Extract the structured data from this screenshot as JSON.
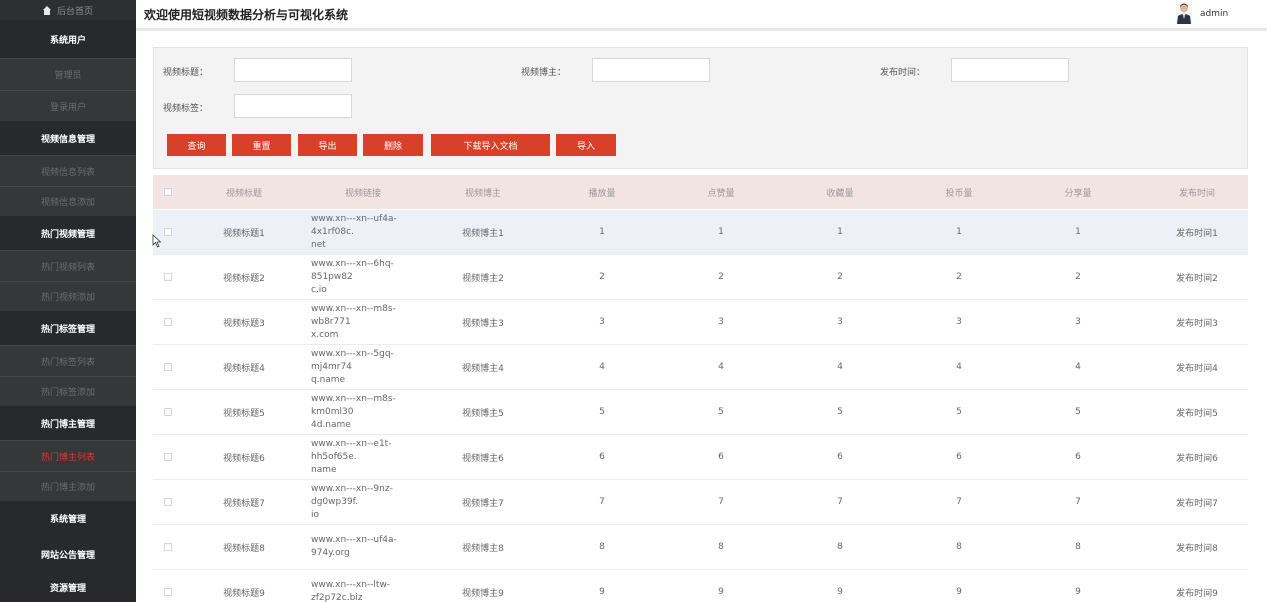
{
  "sidebar": {
    "home_label": "后台首页",
    "items": [
      {
        "label": "系统用户",
        "type": "cat"
      },
      {
        "label": "管理员",
        "type": "sub"
      },
      {
        "label": "登录用户",
        "type": "sub"
      },
      {
        "label": "视频信息管理",
        "type": "cat"
      },
      {
        "label": "视频信息列表",
        "type": "sub"
      },
      {
        "label": "视频信息添加",
        "type": "sub"
      },
      {
        "label": "热门视频管理",
        "type": "cat"
      },
      {
        "label": "热门视频列表",
        "type": "sub"
      },
      {
        "label": "热门视频添加",
        "type": "sub"
      },
      {
        "label": "热门标签管理",
        "type": "cat"
      },
      {
        "label": "热门标签列表",
        "type": "sub"
      },
      {
        "label": "热门标签添加",
        "type": "sub"
      },
      {
        "label": "热门博主管理",
        "type": "cat"
      },
      {
        "label": "热门博主列表",
        "type": "sub",
        "active": true
      },
      {
        "label": "热门博主添加",
        "type": "sub"
      },
      {
        "label": "系统管理",
        "type": "cat"
      },
      {
        "label": "网站公告管理",
        "type": "cat"
      },
      {
        "label": "资源管理",
        "type": "cat"
      }
    ]
  },
  "header": {
    "title": "欢迎使用短视频数据分析与可视化系统",
    "username": "admin"
  },
  "search": {
    "title_label": "视频标题：",
    "blogger_label": "视频博主：",
    "time_label": "发布时间：",
    "tag_label": "视频标签：",
    "title_value": "",
    "blogger_value": "",
    "time_value": "",
    "tag_value": "",
    "buttons": {
      "query": "查询",
      "reset": "重置",
      "export": "导出",
      "delete": "删除",
      "download_doc": "下载导入文档",
      "import": "导入"
    }
  },
  "table": {
    "columns": [
      "视频标题",
      "视频链接",
      "视频博主",
      "播放量",
      "点赞量",
      "收藏量",
      "投币量",
      "分享量",
      "发布时间"
    ],
    "rows": [
      {
        "title": "视频标题1",
        "link": "www.xn---xn--uf4a-4x1rf08c.net",
        "link1": "www.xn---xn--uf4a-4x1rf08c.",
        "link2": "net",
        "blogger": "视频博主1",
        "plays": "1",
        "likes": "1",
        "favs": "1",
        "coins": "1",
        "shares": "1",
        "time": "发布时间1"
      },
      {
        "title": "视频标题2",
        "link": "www.xn---xn--6hq-851pw82c.io",
        "link1": "www.xn---xn--6hq-851pw82",
        "link2": "c.io",
        "blogger": "视频博主2",
        "plays": "2",
        "likes": "2",
        "favs": "2",
        "coins": "2",
        "shares": "2",
        "time": "发布时间2"
      },
      {
        "title": "视频标题3",
        "link": "www.xn---xn--m8s-wb8r771x.com",
        "link1": "www.xn---xn--m8s-wb8r771",
        "link2": "x.com",
        "blogger": "视频博主3",
        "plays": "3",
        "likes": "3",
        "favs": "3",
        "coins": "3",
        "shares": "3",
        "time": "发布时间3"
      },
      {
        "title": "视频标题4",
        "link": "www.xn---xn--5gq-mj4mr74q.name",
        "link1": "www.xn---xn--5gq-mj4mr74",
        "link2": "q.name",
        "blogger": "视频博主4",
        "plays": "4",
        "likes": "4",
        "favs": "4",
        "coins": "4",
        "shares": "4",
        "time": "发布时间4"
      },
      {
        "title": "视频标题5",
        "link": "www.xn---xn--m8s-km0ml304d.name",
        "link1": "www.xn---xn--m8s-km0ml30",
        "link2": "4d.name",
        "blogger": "视频博主5",
        "plays": "5",
        "likes": "5",
        "favs": "5",
        "coins": "5",
        "shares": "5",
        "time": "发布时间5"
      },
      {
        "title": "视频标题6",
        "link": "www.xn---xn--e1t-hh5of65e.name",
        "link1": "www.xn---xn--e1t-hh5of65e.",
        "link2": "name",
        "blogger": "视频博主6",
        "plays": "6",
        "likes": "6",
        "favs": "6",
        "coins": "6",
        "shares": "6",
        "time": "发布时间6"
      },
      {
        "title": "视频标题7",
        "link": "www.xn---xn--9nz-dg0wp39f.io",
        "link1": "www.xn---xn--9nz-dg0wp39f.",
        "link2": "io",
        "blogger": "视频博主7",
        "plays": "7",
        "likes": "7",
        "favs": "7",
        "coins": "7",
        "shares": "7",
        "time": "发布时间7"
      },
      {
        "title": "视频标题8",
        "link": "www.xn---xn--uf4a-974y.org",
        "link1": "www.xn---xn--uf4a-974y.org",
        "link2": "",
        "blogger": "视频博主8",
        "plays": "8",
        "likes": "8",
        "favs": "8",
        "coins": "8",
        "shares": "8",
        "time": "发布时间8"
      },
      {
        "title": "视频标题9",
        "link": "www.xn---xn--ltw-zf2p72c.biz",
        "link1": "www.xn---xn--ltw-zf2p72c.biz",
        "link2": "",
        "blogger": "视频博主9",
        "plays": "9",
        "likes": "9",
        "favs": "9",
        "coins": "9",
        "shares": "9",
        "time": "发布时间9"
      }
    ]
  },
  "colors": {
    "sidebar_bg": "#3a3d42",
    "accent_red": "#d9402a",
    "table_header_bg": "#f3e4e4",
    "row_highlight": "#edf1f7"
  },
  "icons": {
    "home": "home-icon",
    "avatar": "user-avatar",
    "cursor": "mouse-cursor-icon"
  }
}
